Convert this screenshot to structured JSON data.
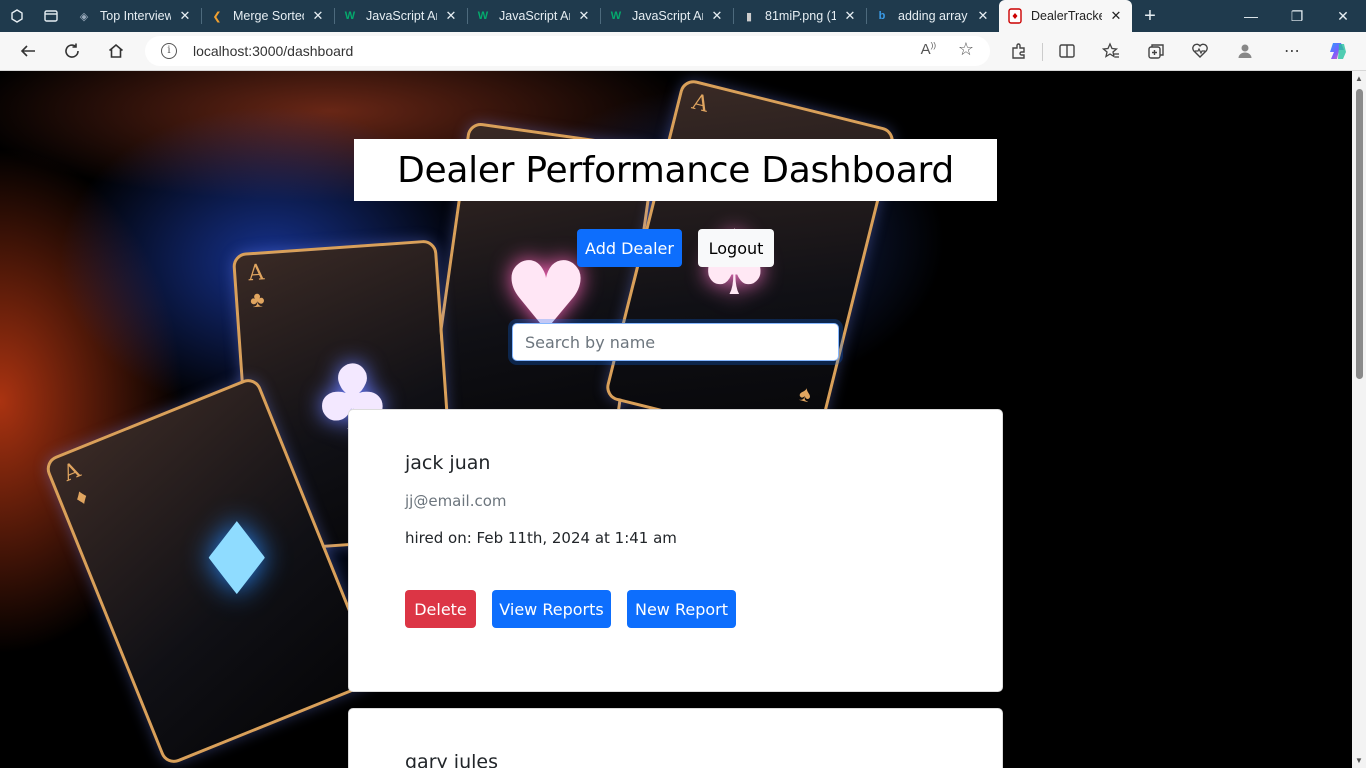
{
  "browser": {
    "tabs": [
      {
        "title": "Top Interview",
        "favicon": "layers-icon",
        "active": false
      },
      {
        "title": "Merge Sorted",
        "favicon": "leetcode-icon",
        "active": false
      },
      {
        "title": "JavaScript Ar",
        "favicon": "w3schools-icon",
        "active": false
      },
      {
        "title": "JavaScript Ar",
        "favicon": "w3schools-icon",
        "active": false
      },
      {
        "title": "JavaScript Ar",
        "favicon": "w3schools-icon",
        "active": false
      },
      {
        "title": "81miP.png (1",
        "favicon": "image-file-icon",
        "active": false
      },
      {
        "title": "adding array",
        "favicon": "bing-icon",
        "active": false
      },
      {
        "title": "DealerTracke",
        "favicon": "playing-card-icon",
        "active": true
      }
    ],
    "url": "localhost:3000/dashboard"
  },
  "dashboard": {
    "title": "Dealer Performance Dashboard",
    "add_dealer_label": "Add Dealer",
    "logout_label": "Logout",
    "search_placeholder": "Search by name"
  },
  "dealers": [
    {
      "name": "jack juan",
      "email": "jj@email.com",
      "hired": "hired on: Feb 11th, 2024 at 1:41 am",
      "delete_label": "Delete",
      "view_reports_label": "View Reports",
      "new_report_label": "New Report"
    },
    {
      "name": "gary jules"
    }
  ],
  "colors": {
    "primary": "#0d6efd",
    "danger": "#dc3545",
    "light": "#f8f9fa",
    "tabbar": "#1f3a4d"
  }
}
